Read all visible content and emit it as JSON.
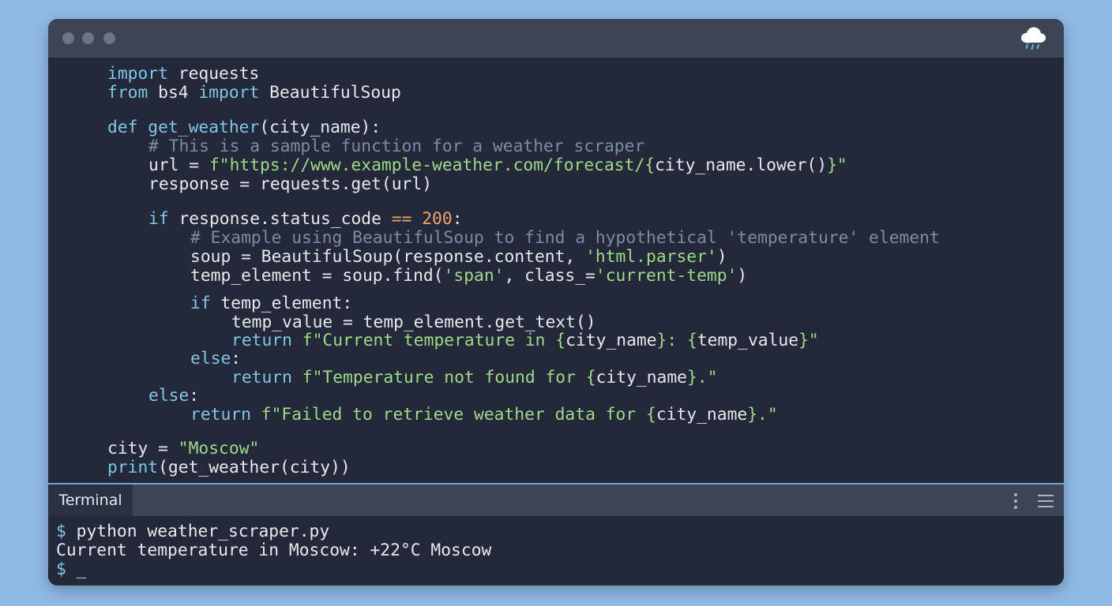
{
  "editor": {
    "lines": {
      "l1": {
        "kw1": "import",
        "rest": " requests"
      },
      "l2": {
        "kw1": "from",
        "mid": " bs4 ",
        "kw2": "import",
        "rest": " BeautifulSoup"
      },
      "l4": {
        "kw1": "def",
        "fn": " get_weather",
        "rest": "(city_name):"
      },
      "l5": {
        "comment": "# This is a sample function for a weather scraper"
      },
      "l6": {
        "pre": "url = ",
        "str": "f\"https://www.example-weather.com/forecast/{",
        "mid": "city_name.lower()",
        "str2": "}\""
      },
      "l7": {
        "text": "response = requests.get(url)"
      },
      "l9": {
        "kw1": "if",
        "pre": " response.status_code ",
        "op": "==",
        "sp": " ",
        "num": "200",
        "rest": ":"
      },
      "l10": {
        "comment": "# Example using BeautifulSoup to find a hypothetical 'temperature' element"
      },
      "l11": {
        "pre": "soup = BeautifulSoup(response.content, ",
        "str": "'html.parser'",
        "rest": ")"
      },
      "l12": {
        "pre": "temp_element = soup.find(",
        "str": "'span'",
        "mid": ", class_=",
        "str2": "'current-temp'",
        "rest": ")"
      },
      "l14": {
        "kw1": "if",
        "rest": " temp_element:"
      },
      "l15": {
        "text": "temp_value = temp_element.get_text()"
      },
      "l16": {
        "kw1": "return",
        "sp": " ",
        "str": "f\"Current temperature in {",
        "v1": "city_name",
        "str2": "}: {",
        "v2": "temp_value",
        "str3": "}\""
      },
      "l17": {
        "kw1": "else",
        "rest": ":"
      },
      "l18": {
        "kw1": "return",
        "sp": " ",
        "str": "f\"Temperature not found for {",
        "v1": "city_name",
        "str2": "}.\""
      },
      "l19": {
        "kw1": "else",
        "rest": ":"
      },
      "l20": {
        "kw1": "return",
        "sp": " ",
        "str": "f\"Failed to retrieve weather data for {",
        "v1": "city_name",
        "str2": "}.\""
      },
      "l22": {
        "pre": "city = ",
        "str": "\"Moscow\""
      },
      "l23": {
        "kw1": "print",
        "rest": "(get_weather(city))"
      }
    }
  },
  "terminal": {
    "tab_label": "Terminal",
    "line1_prompt": "$",
    "line1_cmd": " python weather_scraper.py",
    "line2": "Current temperature in Moscow: +22°C Moscow",
    "line3_prompt": "$",
    "line3_cursor": " _"
  },
  "icons": {
    "titlebar": "rain-cloud-icon",
    "panel_more": "kebab-icon",
    "panel_menu": "hamburger-icon"
  },
  "colors": {
    "background": "#8fbbe3",
    "editor_bg": "#232938",
    "titlebar_bg": "#3b4556",
    "keyword": "#7fc6e8",
    "comment": "#7d8ba5",
    "string": "#9fd98a",
    "number": "#f0a46c"
  }
}
